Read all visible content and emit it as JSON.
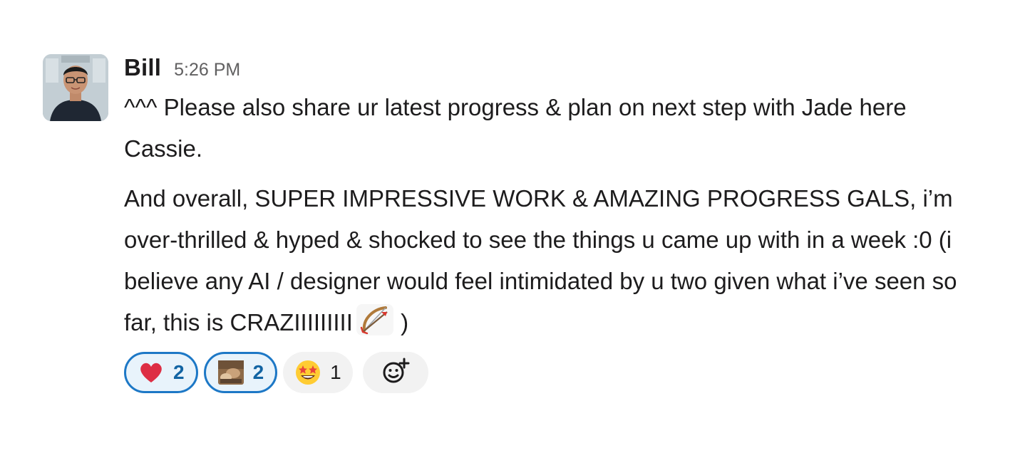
{
  "message": {
    "sender": "Bill",
    "timestamp": "5:26 PM",
    "paragraph1": "^^^ Please also share ur latest progress & plan on next step with Jade here Cassie.",
    "paragraph2": "And overall, SUPER IMPRESSIVE WORK & AMAZING PROGRESS GALS, i’m over-thrilled & hyped & shocked to see the things u came up with in a week :0 (i believe any AI / designer would feel intimidated by u two given what i’ve seen so far, this is CRAZIIIIIIIII",
    "paragraph2_end": " )",
    "inline_emoji": "bow-and-arrow-icon"
  },
  "reactions": [
    {
      "emoji": "heart-icon",
      "count": "2",
      "active": true
    },
    {
      "emoji": "custom-photo-icon",
      "count": "2",
      "active": true
    },
    {
      "emoji": "star-struck-icon",
      "count": "1",
      "active": false
    }
  ],
  "add_reaction_icon": "add-reaction-icon",
  "colors": {
    "active_border": "#1d78c6",
    "active_bg": "#e8f3fb",
    "active_text": "#1264a3",
    "inactive_bg": "#f2f2f2",
    "text": "#1d1c1d",
    "muted": "#616061"
  }
}
